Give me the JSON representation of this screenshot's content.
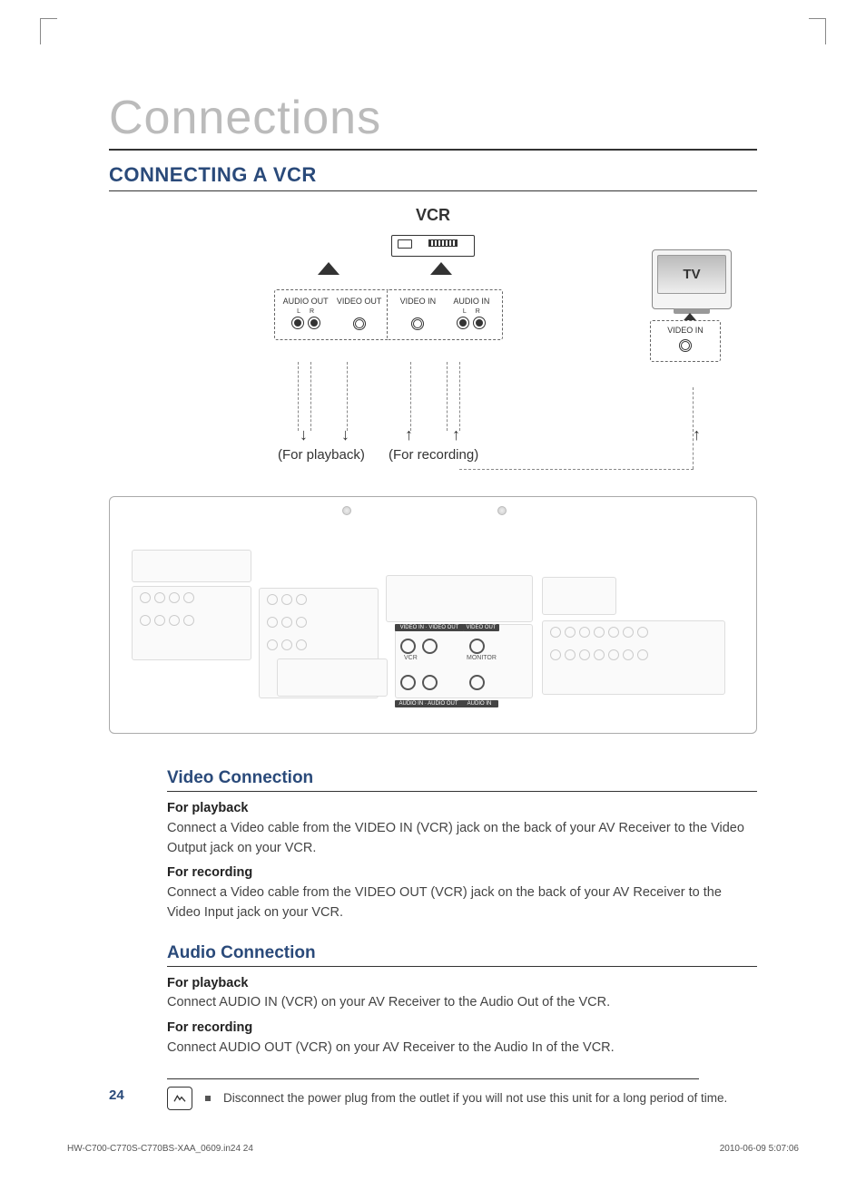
{
  "chapter": "Connections",
  "section": "CONNECTING A VCR",
  "diagram": {
    "vcr_label": "VCR",
    "tv_label": "TV",
    "panel1": {
      "col1_label": "AUDIO OUT",
      "col2_label": "VIDEO OUT",
      "lr_l": "L",
      "lr_r": "R"
    },
    "panel2": {
      "col1_label": "VIDEO IN",
      "col2_label": "AUDIO IN",
      "lr_l": "L",
      "lr_r": "R"
    },
    "panel3": {
      "label": "VIDEO IN"
    },
    "purpose_playback": "(For playback)",
    "purpose_recording": "(For recording)",
    "receiver_strip_video_in": "VIDEO IN",
    "receiver_strip_video_out": "VIDEO OUT",
    "receiver_strip_audio_in": "AUDIO IN",
    "receiver_strip_audio_out": "AUDIO OUT",
    "receiver_vcr": "VCR",
    "receiver_monitor": "MONITOR"
  },
  "video": {
    "heading": "Video Connection",
    "playback_title": "For playback",
    "playback_body": "Connect a Video cable from the VIDEO IN (VCR) jack on the back of your AV Receiver to the Video Output jack on your VCR.",
    "recording_title": "For recording",
    "recording_body": "Connect a Video cable from the VIDEO OUT (VCR) jack on the back of your AV Receiver to the Video Input jack on your VCR."
  },
  "audio": {
    "heading": "Audio Connection",
    "playback_title": "For playback",
    "playback_body": "Connect AUDIO IN (VCR) on your AV Receiver to the Audio Out of the VCR.",
    "recording_title": "For recording",
    "recording_body": "Connect AUDIO OUT (VCR) on your AV Receiver to the Audio In of the VCR."
  },
  "note": "Disconnect the power plug from the outlet if you will not use this unit for a long period of time.",
  "page_number": "24",
  "footer_left": "HW-C700-C770S-C770BS-XAA_0609.in24   24",
  "footer_right": "2010-06-09   5:07:06"
}
